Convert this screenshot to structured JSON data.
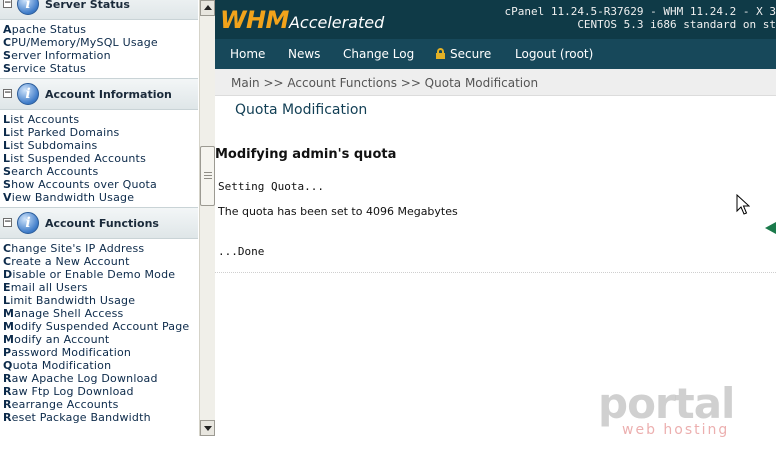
{
  "sidebar": {
    "top_list": [
      "Apache Status",
      "CPU/Memory/MySQL Usage",
      "Server Information",
      "Service Status"
    ],
    "sections": [
      {
        "title": "Server Status",
        "toggle": "−"
      },
      {
        "title": "Account Information",
        "toggle": "−",
        "items": [
          "List Accounts",
          "List Parked Domains",
          "List Subdomains",
          "List Suspended Accounts",
          "Search Accounts",
          "Show Accounts over Quota",
          "View Bandwidth Usage"
        ]
      },
      {
        "title": "Account Functions",
        "toggle": "−",
        "items": [
          "Change Site's IP Address",
          "Create a New Account",
          "Disable or Enable Demo Mode",
          "Email all Users",
          "Limit Bandwidth Usage",
          "Manage Shell Access",
          "Modify Suspended Account Page",
          "Modify an Account",
          "Password Modification",
          "Quota Modification",
          "Raw Apache Log Download",
          "Raw Ftp Log Download",
          "Rearrange Accounts",
          "Reset Package Bandwidth"
        ]
      }
    ]
  },
  "header": {
    "logo_main": "WHM",
    "logo_sub": "Accelerated",
    "version_line1": "cPanel 11.24.5-R37629 - WHM 11.24.2 - X 3",
    "version_line2": "CENTOS 5.3 i686 standard on st",
    "nav": [
      "Home",
      "News",
      "Change Log",
      "Secure",
      "Logout (root)"
    ]
  },
  "breadcrumb": "Main >> Account Functions >> Quota Modification",
  "main": {
    "title": "Quota Modification",
    "subtitle": "Modifying admin's quota",
    "setting": "Setting Quota...",
    "message": "The quota has been set to 4096 Megabytes",
    "done": "...Done"
  },
  "watermark": {
    "brand": "portal",
    "tagline": "web hosting"
  },
  "colors": {
    "header_bg": "#0f3a47",
    "nav_bg": "#17485a",
    "logo_accent": "#f2a31b",
    "title_color": "#123f55"
  },
  "icons": {
    "section_toggle": "minus-box-icon",
    "section_info": "info-icon",
    "secure": "lock-icon",
    "cursor": "mouse-pointer-icon",
    "arrow": "green-arrow-icon"
  }
}
